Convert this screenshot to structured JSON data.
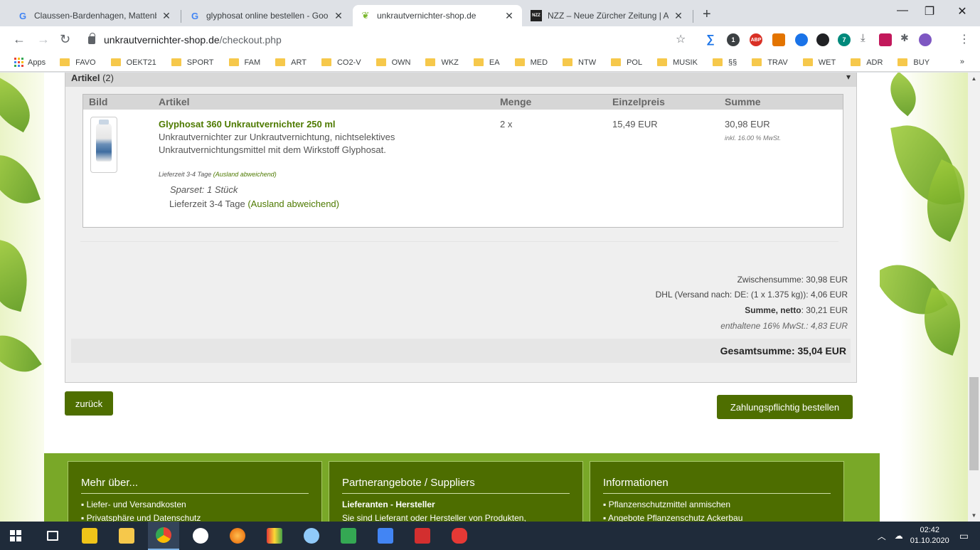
{
  "browser": {
    "tabs": [
      {
        "title": "Claussen-Bardenhagen, Mattenb",
        "favicon": "google-icon",
        "active": false
      },
      {
        "title": "glyphosat online bestellen - Goo",
        "favicon": "google-icon",
        "active": false
      },
      {
        "title": "unkrautvernichter-shop.de",
        "favicon": "shop-leaf-icon",
        "active": true
      },
      {
        "title": "NZZ – Neue Zürcher Zeitung | Ak",
        "favicon": "nzz-icon",
        "active": false
      }
    ],
    "nzz_favicon_text": "NZZ",
    "url_host": "unkrautvernichter-shop.de",
    "url_path": "/checkout.php",
    "ext_badges": {
      "abp": "ABP",
      "one": "1",
      "seven": "7"
    },
    "bookmarks_apps": "Apps",
    "bookmarks": [
      "FAVO",
      "OEKT21",
      "SPORT",
      "FAM",
      "ART",
      "CO2-V",
      "OWN",
      "WKZ",
      "EA",
      "MED",
      "NTW",
      "POL",
      "MUSIK",
      "§§",
      "TRAV",
      "WET",
      "ADR",
      "BUY"
    ],
    "bookmarks_more": "»"
  },
  "checkout": {
    "articles_title": "Artikel",
    "articles_count": "(2)",
    "columns": {
      "image": "Bild",
      "article": "Artikel",
      "qty": "Menge",
      "unit_price": "Einzelpreis",
      "sum": "Summe"
    },
    "item": {
      "name": "Glyphosat 360 Unkrautvernichter 250 ml",
      "desc_line1": "Unkrautvernichter zur Unkrautvernichtung, nichtselektives",
      "desc_line2": "Unkrautvernichtungsmittel mit dem Wirkstoff Glyphosat.",
      "delivery_small_prefix": "Lieferzeit 3-4 Tage",
      "delivery_small_link": "(Ausland abweichend)",
      "sparset": "Sparset: 1 Stück",
      "delivery_prefix": "Lieferzeit 3-4 Tage",
      "delivery_link": "(Ausland abweichend)",
      "qty": "2 x",
      "unit_price": "15,49 EUR",
      "sum": "30,98 EUR",
      "vat_note": "inkl. 16.00 % MwSt."
    },
    "totals": {
      "subtotal_label": "Zwischensumme:",
      "subtotal_value": "30,98 EUR",
      "shipping_label": "DHL (Versand nach: DE: (1 x 1.375 kg)):",
      "shipping_value": "4,06 EUR",
      "net_label": "Summe, netto",
      "net_value": ": 30,21 EUR",
      "vat_text": "enthaltene 16% MwSt.: 4,83 EUR",
      "grand_total": "Gesamtsumme: 35,04 EUR"
    },
    "back_button": "zurück",
    "order_button": "Zahlungspflichtig bestellen"
  },
  "footer": {
    "col1_title": "Mehr über...",
    "col1_items": [
      "Liefer- und Versandkosten",
      "Privatsphäre und Datenschutz"
    ],
    "col2_title": "Partnerangebote / Suppliers",
    "col2_strong": "Lieferanten - Hersteller",
    "col2_text": "Sie sind Lieferant oder Hersteller von Produkten,",
    "col3_title": "Informationen",
    "col3_items": [
      "Pflanzenschutzmittel anmischen",
      "Angebote Pflanzenschutz Ackerbau"
    ]
  },
  "taskbar": {
    "time": "02:42",
    "date": "01.10.2020"
  },
  "colors": {
    "brand_green": "#4e6e00",
    "link_green": "#4e7a00",
    "footer_green": "#79a828"
  }
}
